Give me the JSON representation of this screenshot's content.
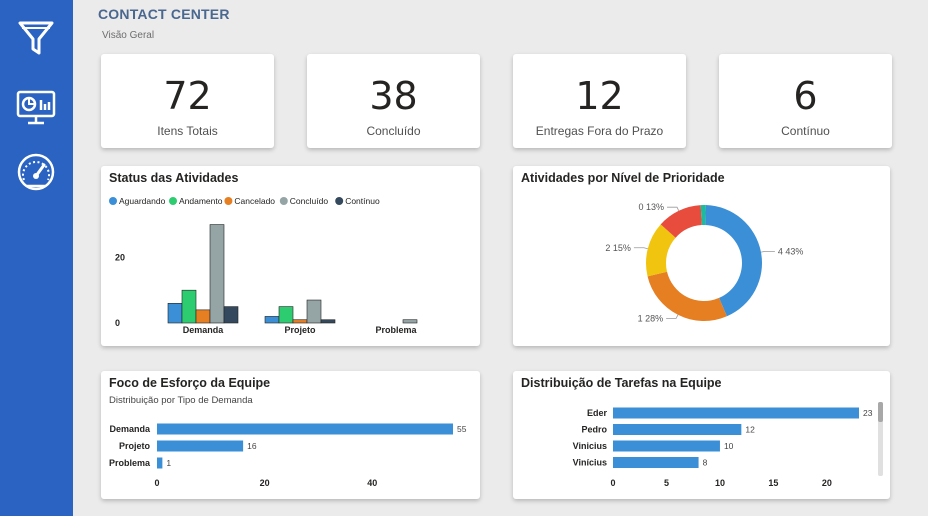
{
  "header": {
    "title": "CONTACT CENTER",
    "subtitle": "Visão Geral"
  },
  "sidebar": {
    "icons": [
      "filter-icon",
      "dashboard-screen-icon",
      "gauge-icon"
    ],
    "color": "#2a63c1"
  },
  "kpis": [
    {
      "value": "72",
      "label": "Itens Totais"
    },
    {
      "value": "38",
      "label": "Concluído"
    },
    {
      "value": "12",
      "label": "Entregas Fora do Prazo"
    },
    {
      "value": "6",
      "label": "Contínuo"
    }
  ],
  "status_panel": {
    "title": "Status das Atividades"
  },
  "priority_panel": {
    "title": "Atividades por Nível de Prioridade"
  },
  "effort_panel": {
    "title": "Foco de Esforço da Equipe",
    "subtitle": "Distribuição por Tipo de Demanda"
  },
  "team_panel": {
    "title": "Distribuição de Tarefas na Equipe"
  },
  "chart_data": [
    {
      "type": "bar",
      "title": "Status das Atividades",
      "categories": [
        "Demanda",
        "Projeto",
        "Problema"
      ],
      "series": [
        {
          "name": "Aguardando",
          "color": "#3a8fd6",
          "values": [
            6,
            2,
            0
          ]
        },
        {
          "name": "Andamento",
          "color": "#2ecc71",
          "values": [
            10,
            5,
            0
          ]
        },
        {
          "name": "Cancelado",
          "color": "#e67e22",
          "values": [
            4,
            1,
            0
          ]
        },
        {
          "name": "Concluído",
          "color": "#95a5a6",
          "values": [
            30,
            7,
            1
          ]
        },
        {
          "name": "Contínuo",
          "color": "#34495e",
          "values": [
            5,
            1,
            0
          ]
        }
      ],
      "yticks": [
        0,
        20
      ],
      "ylim": [
        0,
        32
      ],
      "legend": "top"
    },
    {
      "type": "pie",
      "title": "Atividades por Nível de Prioridade",
      "slices": [
        {
          "label": "4",
          "percent": 43,
          "value": 31,
          "color": "#3a8fd6",
          "text": "4 43%"
        },
        {
          "label": "1",
          "percent": 28,
          "value": 20,
          "color": "#e67e22",
          "text": "1 28%"
        },
        {
          "label": "2",
          "percent": 15,
          "value": 11,
          "color": "#f1c40f",
          "text": "2 15%"
        },
        {
          "label": "0",
          "percent": 13,
          "value": 9,
          "color": "#e74c3c",
          "text": "0 13%"
        },
        {
          "label": "",
          "percent": 1,
          "value": 1,
          "color": "#1abc9c",
          "text": ""
        }
      ],
      "donut": true
    },
    {
      "type": "bar",
      "orientation": "horizontal",
      "title": "Foco de Esforço da Equipe",
      "subtitle": "Distribuição por Tipo de Demanda",
      "categories": [
        "Demanda",
        "Projeto",
        "Problema"
      ],
      "values": [
        55,
        16,
        1
      ],
      "xticks": [
        0,
        20,
        40
      ],
      "xlim": [
        0,
        55
      ],
      "color": "#3a8fd6"
    },
    {
      "type": "bar",
      "orientation": "horizontal",
      "title": "Distribuição de Tarefas na Equipe",
      "categories": [
        "Eder",
        "Pedro",
        "Vinicius",
        "Vinícius"
      ],
      "values": [
        23,
        12,
        10,
        8
      ],
      "xticks": [
        0,
        5,
        10,
        15,
        20
      ],
      "xlim": [
        0,
        23
      ],
      "color": "#3a8fd6"
    }
  ]
}
